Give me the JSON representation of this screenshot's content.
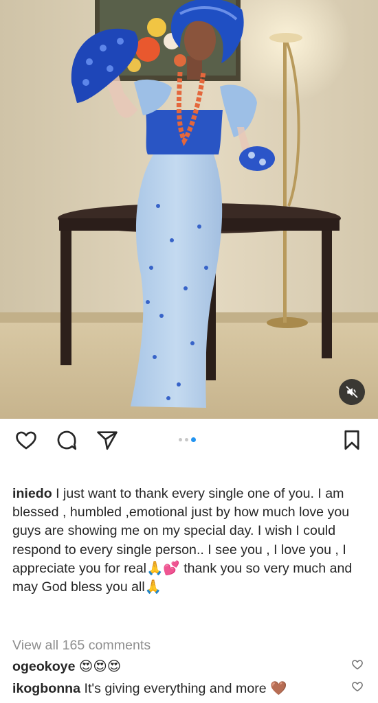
{
  "post": {
    "image_alt": "Woman in blue lace gown and gele holding a hand fan, standing before a round wooden table",
    "mute_icon": "speaker-muted-icon",
    "carousel": {
      "count": 3,
      "active_index": 2
    }
  },
  "actions": {
    "like_icon": "heart-icon",
    "comment_icon": "speech-bubble-icon",
    "share_icon": "paper-plane-icon",
    "save_icon": "bookmark-icon"
  },
  "caption": {
    "username": "iniedo",
    "lines": [
      "I just want to thank every single one of you. I am",
      "blessed , humbled ,emotional just by how much love you",
      "guys are showing me on my special day. I wish I could",
      "respond to every single person.. I see you , I love you , I",
      "appreciate you for real🙏💕 thank you so very much and",
      "may God bless you all🙏"
    ]
  },
  "comments": {
    "view_all": "View all 165 comments",
    "items": [
      {
        "username": "ogeokoye",
        "text": "😍😍😍"
      },
      {
        "username": "ikogbonna",
        "text": "It's giving everything and more 🤎"
      }
    ]
  },
  "colors": {
    "text": "#262626",
    "muted": "#8e8e8e",
    "carousel_active": "#2394f0",
    "carousel_inactive": "#c7c7c7"
  }
}
